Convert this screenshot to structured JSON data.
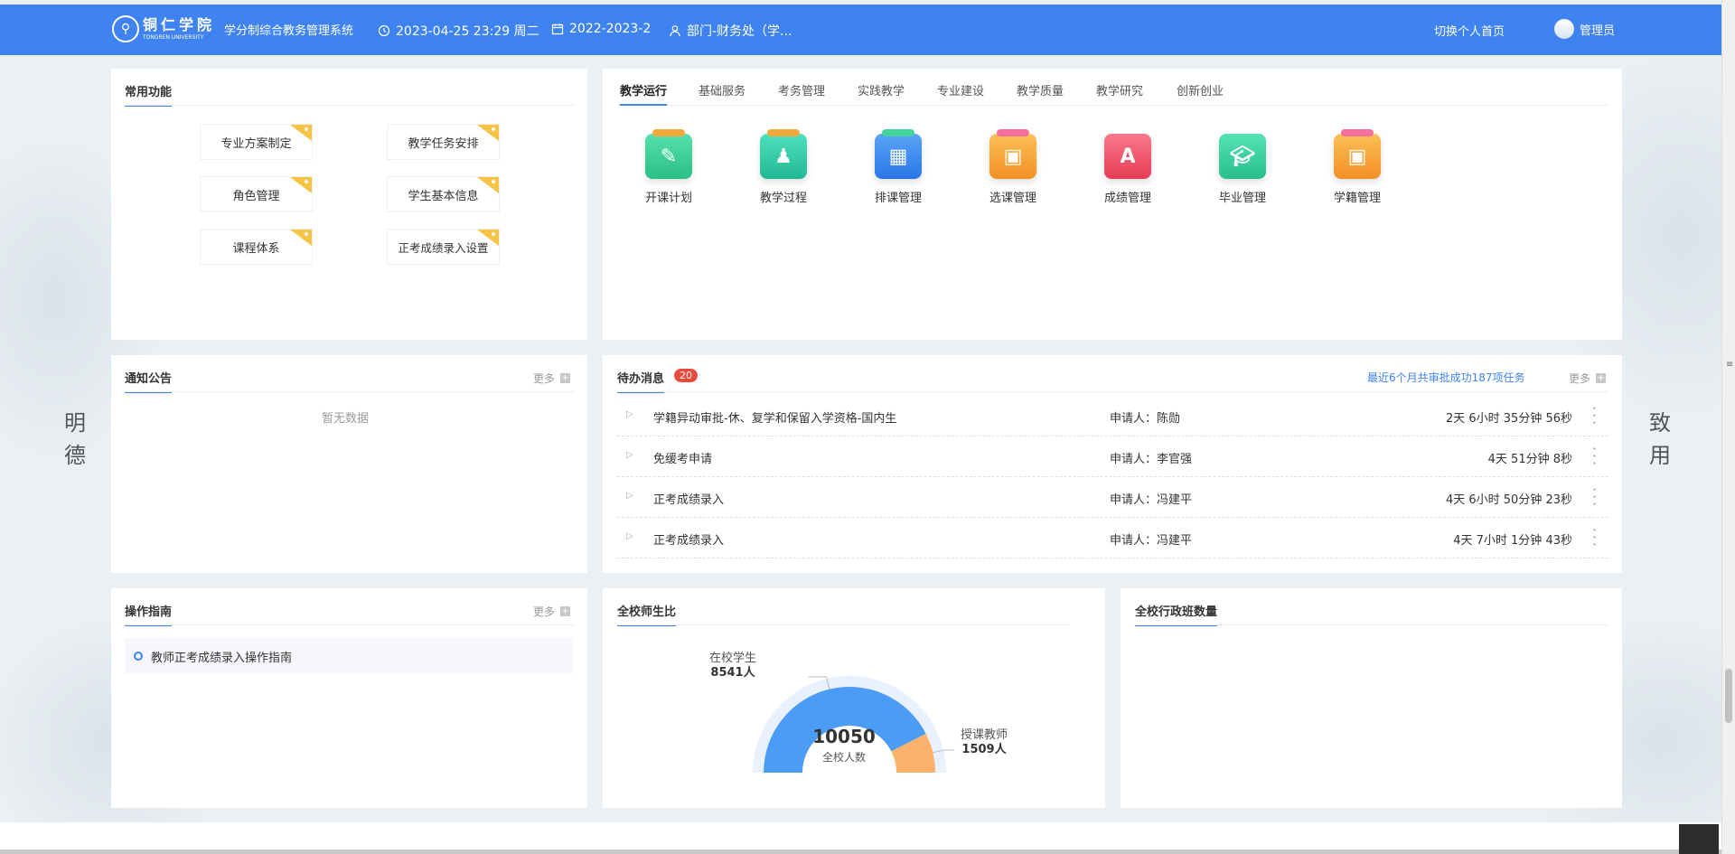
{
  "header": {
    "school_cn": "铜仁学院",
    "school_en": "TONGREN UNIVERSITY",
    "system_name": "学分制综合教务管理系统",
    "datetime": "2023-04-25 23:29 周二",
    "term": "2022-2023-2",
    "department": "部门-财务处（学...",
    "switch_home": "切换个人首页",
    "user": "管理员",
    "bg_color": "#3f83f0"
  },
  "common": {
    "title": "常用功能",
    "items": [
      "专业方案制定",
      "教学任务安排",
      "角色管理",
      "学生基本信息",
      "课程体系",
      "正考成绩录入设置"
    ]
  },
  "tabs": {
    "items": [
      "教学运行",
      "基础服务",
      "考务管理",
      "实践教学",
      "专业建设",
      "教学质量",
      "教学研究",
      "创新创业"
    ],
    "active": "教学运行"
  },
  "apps": [
    {
      "label": "开课计划",
      "icon": "course-plan-icon",
      "color": "#3ecf9a"
    },
    {
      "label": "教学过程",
      "icon": "teaching-process-icon",
      "color": "#2ec9a4"
    },
    {
      "label": "排课管理",
      "icon": "schedule-icon",
      "color": "#3b8df0"
    },
    {
      "label": "选课管理",
      "icon": "course-select-icon",
      "color": "#f7a933"
    },
    {
      "label": "成绩管理",
      "icon": "grade-icon",
      "color": "#f0566a"
    },
    {
      "label": "毕业管理",
      "icon": "graduation-icon",
      "color": "#2ecc9a"
    },
    {
      "label": "学籍管理",
      "icon": "student-record-icon",
      "color": "#f7a933"
    }
  ],
  "notice": {
    "title": "通知公告",
    "more": "更多",
    "empty": "暂无数据"
  },
  "todo": {
    "title": "待办消息",
    "count": "20",
    "summary": "最近6个月共审批成功187项任务",
    "more": "更多",
    "rows": [
      {
        "title": "学籍异动审批-休、复学和保留入学资格-国内生",
        "applicant": "申请人：陈勋",
        "time": "2天 6小时 35分钟 56秒"
      },
      {
        "title": "免缓考申请",
        "applicant": "申请人：李官强",
        "time": "4天 51分钟 8秒"
      },
      {
        "title": "正考成绩录入",
        "applicant": "申请人：冯建平",
        "time": "4天 6小时 50分钟 23秒"
      },
      {
        "title": "正考成绩录入",
        "applicant": "申请人：冯建平",
        "time": "4天 7小时 1分钟 43秒"
      }
    ]
  },
  "guide": {
    "title": "操作指南",
    "more": "更多",
    "items": [
      "教师正考成绩录入操作指南"
    ]
  },
  "ratio": {
    "title": "全校师生比",
    "student_label": "在校学生",
    "student_value": "8541人",
    "teacher_label": "授课教师",
    "teacher_value": "1509人",
    "total": "10050",
    "total_label": "全校人数"
  },
  "chart_data": {
    "type": "pie",
    "categories": [
      "在校学生",
      "授课教师"
    ],
    "values": [
      8541,
      1509
    ],
    "colors": [
      "#4a9cf5",
      "#fbb26a"
    ]
  },
  "classes": {
    "title": "全校行政班数量"
  },
  "side": {
    "left": [
      "明",
      "德"
    ],
    "right": [
      "致",
      "用"
    ]
  }
}
